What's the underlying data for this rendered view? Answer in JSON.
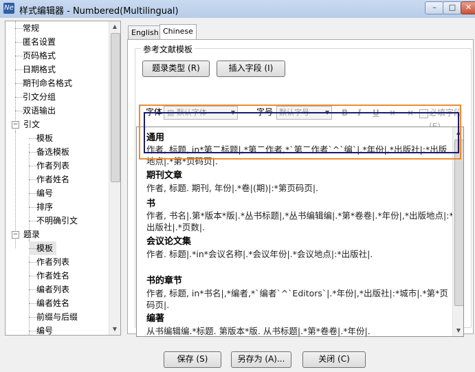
{
  "window": {
    "title": "样式编辑器 - Numbered(Multilingual)",
    "app_icon_text": "Ne",
    "min_glyph": "–",
    "max_glyph": "□",
    "close_glyph": "✕"
  },
  "tree": {
    "top_level": [
      {
        "label": "常规"
      },
      {
        "label": "匿名设置"
      },
      {
        "label": "页码格式"
      },
      {
        "label": "日期格式"
      },
      {
        "label": "期刊命名格式"
      },
      {
        "label": "引文分组"
      },
      {
        "label": "双语输出"
      }
    ],
    "citation": {
      "label": "引文",
      "expander": "−",
      "children": [
        "模板",
        "备选模板",
        "作者列表",
        "作者姓名",
        "编号",
        "排序",
        "不明确引文"
      ]
    },
    "bibliography": {
      "label": "题录",
      "expander": "−",
      "children": [
        "模板",
        "作者列表",
        "作者姓名",
        "编者列表",
        "编者姓名",
        "前缀与后缀",
        "编号"
      ],
      "selected_child": "模板"
    }
  },
  "tabs": [
    "English",
    "Chinese"
  ],
  "active_tab": "Chinese",
  "group": {
    "label": "参考文献模板",
    "ref_type_button": "题录类型 (R)",
    "insert_field_button": "插入字段 (I)",
    "font_label": "字体",
    "font_value": "默认字体",
    "size_label": "字号",
    "size_value": "默认字号",
    "format_buttons": [
      "B",
      "I",
      "U",
      "×",
      "×"
    ],
    "required_field_label": "必填字段(E)"
  },
  "templates": [
    {
      "title": "通用",
      "body": "作者, 标题, in*第二标题|,*第二作者,*`第二作者`^`编`|.*年份|,*出版社|:*出版地点|.*第*页码页|."
    },
    {
      "title": "期刊文章",
      "body": "作者, 标题. 期刊, 年份|.*卷|(期)|:*第页码页|."
    },
    {
      "title": "书",
      "body": "作者, 书名|.第*版本*版|.*丛书标题|,*丛书编辑编|.*第*卷卷|.*年份|,*出版地点|:*出版社|.*页数|."
    },
    {
      "title": "会议论文集",
      "body": "作者. 标题|.*in*会议名称|.*会议年份|.*会议地点|:*出版社|."
    },
    {
      "title": "书的章节",
      "body": "作者, 标题, in*书名|,*编者,*`编者`^`Editors`|.*年份|,*出版社|:*城市|.*第*页码页|."
    },
    {
      "title": "编著",
      "body": "从书编辑编.*标题. 第版本*版. 从书标题|.*第*卷卷|.*年份|."
    }
  ],
  "buttons": {
    "save": "保存 (S)",
    "save_as": "另存为 (A)...",
    "close": "关闭 (C)"
  }
}
